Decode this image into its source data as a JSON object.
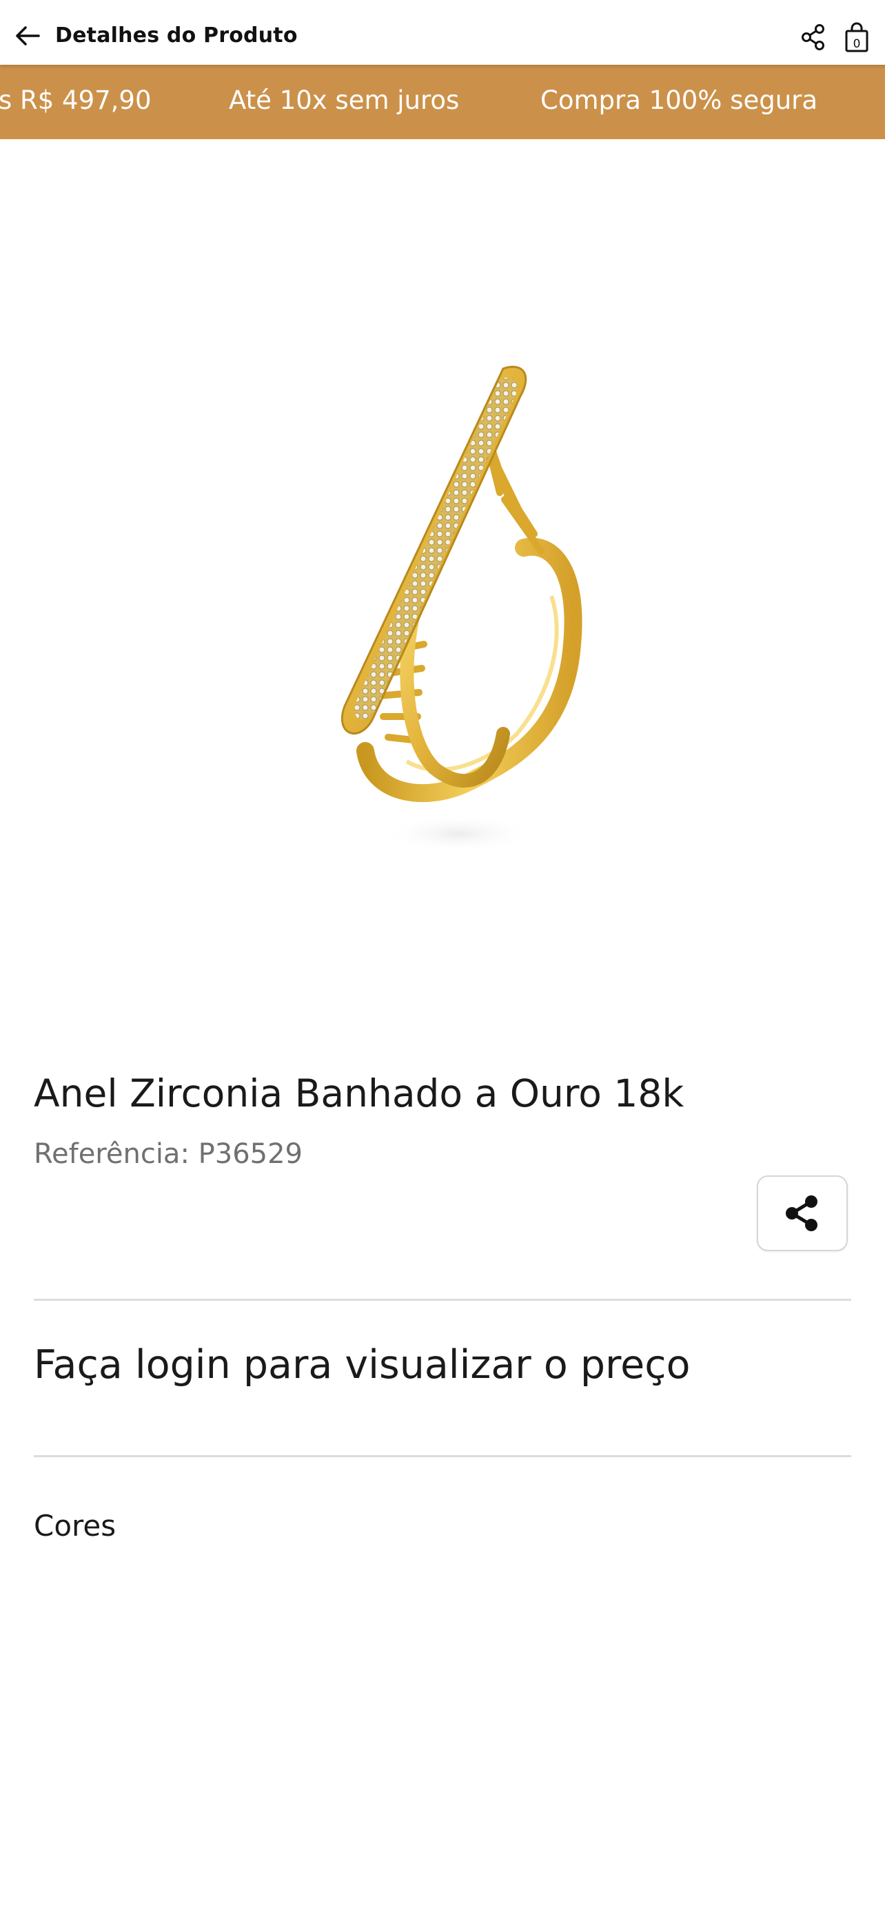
{
  "app_bar": {
    "back_icon": "arrow-left-icon",
    "title": "Detalhes do Produto",
    "share_icon": "share-icon",
    "cart_icon": "shopping-bag-icon",
    "cart_count": "0"
  },
  "promo_strip": {
    "background_color": "#cb914a",
    "items": [
      "s R$ 497,90",
      "Até 10x sem juros",
      "Compra 100% segura"
    ]
  },
  "product": {
    "image_alt": "Anel dourado com zircônias",
    "title": "Anel Zirconia Banhado a Ouro 18k",
    "reference": "Referência: P36529",
    "share_icon": "share-icon",
    "price_message": "Faça login para visualizar o preço",
    "colors_heading": "Cores"
  }
}
